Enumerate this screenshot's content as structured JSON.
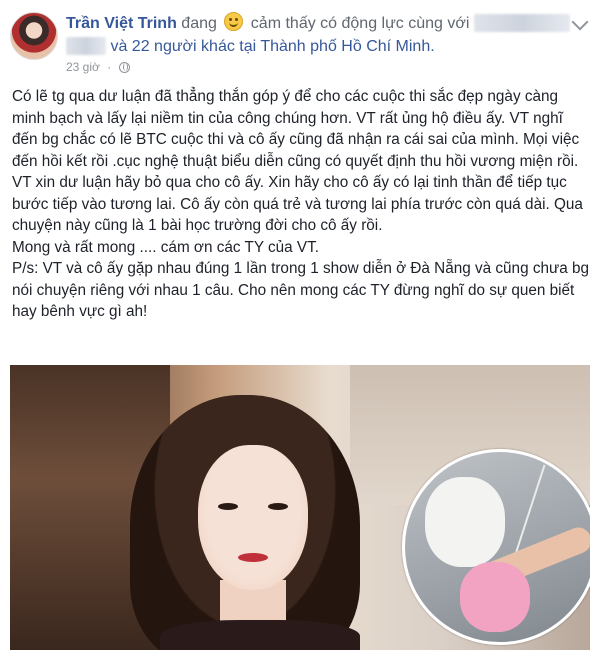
{
  "post": {
    "author": "Trần Việt Trinh",
    "status_prefix": "đang",
    "feeling_icon": "smiley-emoji",
    "feeling_text": "cảm thấy có động lực cùng với",
    "tag_suffix": "và 22 người khác tại Thành phố Hồ Chí Minh.",
    "time": "23 giờ",
    "meta_sep": "·",
    "privacy_icon": "globe-icon",
    "paragraphs": [
      "Có lẽ tg qua dư luận đã thẳng thắn góp ý để cho các cuộc thi sắc đẹp ngày càng minh bạch và lấy lại niềm tin của công chúng hơn. VT rất ủng hộ điều ấy. VT nghĩ đến bg chắc có lẽ BTC cuộc thi và cô ấy cũng đã nhận ra cái sai của mình. Mọi việc đến hồi kết rồi .cục nghệ thuật biểu diễn cũng có quyết định thu hồi vương miện rồi. VT xin dư luận hãy bỏ qua cho cô ấy. Xin hãy cho cô ấy có lại tinh thần để tiếp tục bước tiếp vào tương lai. Cô ấy còn quá trẻ và tương lai phía trước còn quá dài. Qua chuyện này cũng là 1 bài học trường đời cho cô ấy rồi.",
      "Mong và rất mong .... cám ơn các TY của VT.",
      "P/s: VT và cô ấy gặp nhau đúng 1 lần trong 1 show diễn ở Đà Nẵng và cũng chưa bg nói chuyện riêng với nhau 1 câu. Cho nên mong các TY đừng nghĩ do sự quen biết hay bênh vực gì ah!"
    ]
  },
  "colors": {
    "author_link": "#365899",
    "meta": "#90949c",
    "text": "#1d2129"
  }
}
